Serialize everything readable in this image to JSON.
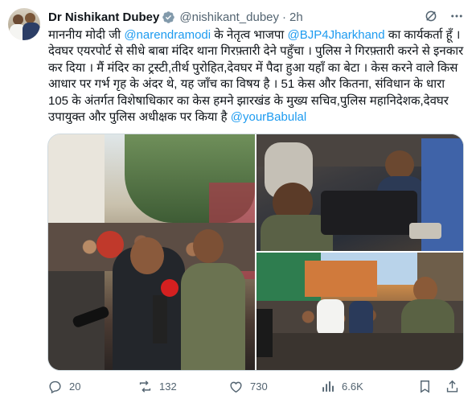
{
  "author": {
    "name": "Dr Nishikant Dubey",
    "handle": "@nishikant_dubey",
    "separator": "·",
    "time": "2h"
  },
  "tweet": {
    "segments": [
      {
        "text": "माननीय मोदी जी ",
        "link": false
      },
      {
        "text": "@narendramodi",
        "link": true
      },
      {
        "text": " के नेतृत्व भाजपा ",
        "link": false
      },
      {
        "text": "@BJP4Jharkhand",
        "link": true
      },
      {
        "text": " का कार्यकर्ता हूँ ।देवघर एयरपोर्ट से सीधे बाबा मंदिर थाना गिरफ़्तारी देने पहुँचा । पुलिस ने गिरफ़्तारी करने से इनकार कर दिया । मैं मंदिर का ट्रस्टी,तीर्थ पुरोहित,देवघर में पैदा हुआ यहाँ का बेटा । केस करने वाले किस आधार पर गर्भ गृह के अंदर थे, यह जाँच का विषय है । 51 केस और कितना, संविधान के धारा 105 के अंतर्गत विशेषाधिकार का केस हमने झारखंड के मुख्य सचिव,पुलिस महानिदेशक,देवघर उपायुक्त और पुलिस अधीक्षक पर किया है ",
        "link": false
      },
      {
        "text": "@yourBabulal",
        "link": true
      }
    ]
  },
  "actions": {
    "replies": "20",
    "reposts": "132",
    "likes": "730",
    "views": "6.6K"
  },
  "icons": {
    "verified": "verified-badge-icon",
    "grok": "grok-icon",
    "more": "more-icon",
    "reply": "reply-icon",
    "repost": "repost-icon",
    "like": "like-icon",
    "views": "views-icon",
    "bookmark": "bookmark-icon",
    "share": "share-icon"
  },
  "colors": {
    "link": "#1d9bf0",
    "secondary": "#536471",
    "text": "#0f1419",
    "border": "#cfd9de"
  }
}
